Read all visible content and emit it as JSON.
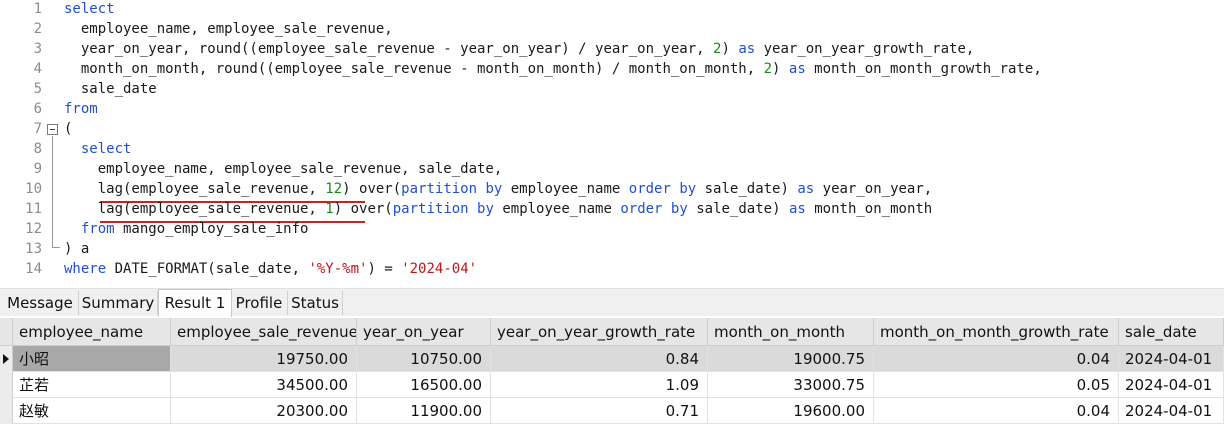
{
  "editor": {
    "line_numbers": [
      "1",
      "2",
      "3",
      "4",
      "5",
      "6",
      "7",
      "8",
      "9",
      "10",
      "11",
      "12",
      "13",
      "14"
    ],
    "lines": [
      [
        {
          "t": "select",
          "c": "kw"
        }
      ],
      [
        {
          "t": "  employee_name, employee_sale_revenue,",
          "c": ""
        }
      ],
      [
        {
          "t": "  year_on_year, round((employee_sale_revenue - year_on_year) / year_on_year, ",
          "c": ""
        },
        {
          "t": "2",
          "c": "num"
        },
        {
          "t": ") ",
          "c": ""
        },
        {
          "t": "as",
          "c": "kw"
        },
        {
          "t": " year_on_year_growth_rate,",
          "c": ""
        }
      ],
      [
        {
          "t": "  month_on_month, round((employee_sale_revenue - month_on_month) / month_on_month, ",
          "c": ""
        },
        {
          "t": "2",
          "c": "num"
        },
        {
          "t": ") ",
          "c": ""
        },
        {
          "t": "as",
          "c": "kw"
        },
        {
          "t": " month_on_month_growth_rate,",
          "c": ""
        }
      ],
      [
        {
          "t": "  sale_date",
          "c": ""
        }
      ],
      [
        {
          "t": "from",
          "c": "kw"
        }
      ],
      [
        {
          "t": "(",
          "c": ""
        }
      ],
      [
        {
          "t": "  ",
          "c": ""
        },
        {
          "t": "select",
          "c": "kw"
        }
      ],
      [
        {
          "t": "    employee_name, employee_sale_revenue, sale_date,",
          "c": ""
        }
      ],
      [
        {
          "t": "    lag(employee_sale_revenue, ",
          "c": ""
        },
        {
          "t": "12",
          "c": "num"
        },
        {
          "t": ") over(",
          "c": ""
        },
        {
          "t": "partition by",
          "c": "kw"
        },
        {
          "t": " employee_name ",
          "c": ""
        },
        {
          "t": "order by",
          "c": "kw"
        },
        {
          "t": " sale_date) ",
          "c": ""
        },
        {
          "t": "as",
          "c": "kw"
        },
        {
          "t": " year_on_year,",
          "c": ""
        }
      ],
      [
        {
          "t": "    lag(employee_sale_revenue, ",
          "c": ""
        },
        {
          "t": "1",
          "c": "num"
        },
        {
          "t": ") over(",
          "c": ""
        },
        {
          "t": "partition by",
          "c": "kw"
        },
        {
          "t": " employee_name ",
          "c": ""
        },
        {
          "t": "order by",
          "c": "kw"
        },
        {
          "t": " sale_date) ",
          "c": ""
        },
        {
          "t": "as",
          "c": "kw"
        },
        {
          "t": " month_on_month",
          "c": ""
        }
      ],
      [
        {
          "t": "  ",
          "c": ""
        },
        {
          "t": "from",
          "c": "kw"
        },
        {
          "t": " mango_employ_sale_info",
          "c": ""
        }
      ],
      [
        {
          "t": ") a",
          "c": ""
        }
      ],
      [
        {
          "t": "where",
          "c": "kw"
        },
        {
          "t": " DATE_FORMAT(sale_date, ",
          "c": ""
        },
        {
          "t": "'%Y-%m'",
          "c": "str"
        },
        {
          "t": ") = ",
          "c": ""
        },
        {
          "t": "'2024-04'",
          "c": "str"
        }
      ]
    ]
  },
  "tabs": [
    "Message",
    "Summary",
    "Result 1",
    "Profile",
    "Status"
  ],
  "active_tab": "Result 1",
  "grid": {
    "columns": [
      "employee_name",
      "employee_sale_revenue",
      "year_on_year",
      "year_on_year_growth_rate",
      "month_on_month",
      "month_on_month_growth_rate",
      "sale_date"
    ],
    "rows": [
      [
        "小昭",
        "19750.00",
        "10750.00",
        "0.84",
        "19000.75",
        "0.04",
        "2024-04-01"
      ],
      [
        "芷若",
        "34500.00",
        "16500.00",
        "1.09",
        "33000.75",
        "0.05",
        "2024-04-01"
      ],
      [
        "赵敏",
        "20300.00",
        "11900.00",
        "0.71",
        "19600.00",
        "0.04",
        "2024-04-01"
      ]
    ],
    "selected_row": 0
  },
  "colors": {
    "keyword": "#1f4fd6",
    "number": "#1a8a1a",
    "string": "#c1141a",
    "underline": "#d61c1c"
  }
}
